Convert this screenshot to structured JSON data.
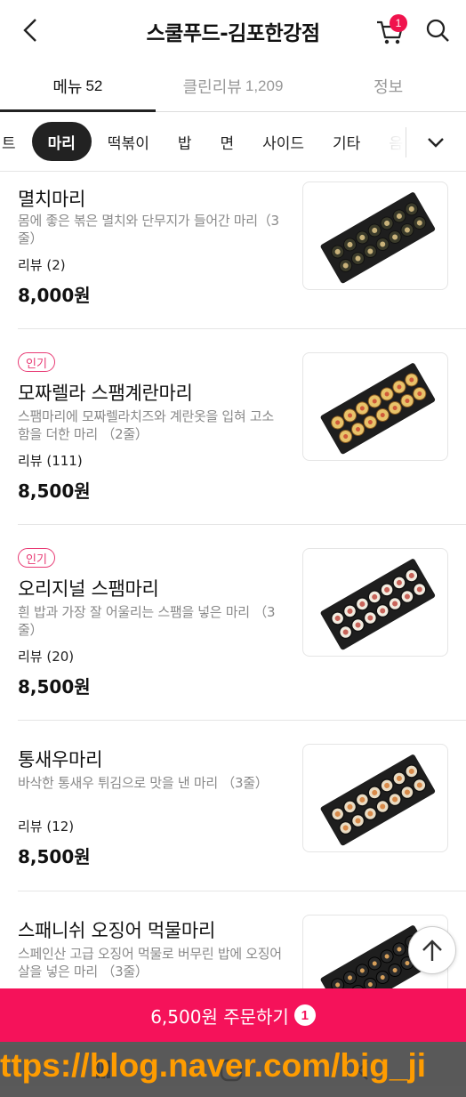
{
  "header": {
    "title": "스쿨푸드-김포한강점",
    "cart_count": "1"
  },
  "main_tabs": [
    {
      "label": "메뉴",
      "count": "52"
    },
    {
      "label": "클린리뷰",
      "count": "1,209"
    },
    {
      "label": "정보",
      "count": ""
    }
  ],
  "categories": {
    "items": [
      "트",
      "마리",
      "떡볶이",
      "밥",
      "면",
      "사이드",
      "기타",
      "음"
    ],
    "selected": "마리"
  },
  "menu": [
    {
      "badge": "",
      "name": "멸치마리",
      "desc": "몸에 좋은 볶은 멸치와 단무지가 들어간 마리（3줄）",
      "review": "리뷰 (2)",
      "price": "8,000원"
    },
    {
      "badge": "인기",
      "name": "모짜렐라 스팸계란마리",
      "desc": "스팸마리에 모짜렐라치즈와 계란옷을 입혀 고소함을 더한 마리 （2줄）",
      "review": "리뷰 (111)",
      "price": "8,500원"
    },
    {
      "badge": "인기",
      "name": "오리지널 스팸마리",
      "desc": "흰 밥과 가장 잘 어울리는 스팸을 넣은 마리 （3줄）",
      "review": "리뷰 (20)",
      "price": "8,500원"
    },
    {
      "badge": "",
      "name": "통새우마리",
      "desc": "바삭한 통새우 튀김으로 맛을 낸 마리 （3줄）",
      "review": "리뷰 (12)",
      "price": "8,500원"
    },
    {
      "badge": "",
      "name": "스패니쉬 오징어 먹물마리",
      "desc": "스페인산 고급 오징어 먹물로 버무린 밥에 오징어 살을 넣은 마리 （3줄）",
      "review": "",
      "price": ""
    }
  ],
  "order_bar": {
    "label": "6,500원 주문하기",
    "count": "1"
  },
  "watermark": "ttps://blog.naver.com/big_ji",
  "colors": {
    "accent": "#f5125a",
    "badge": "#e83a74"
  }
}
